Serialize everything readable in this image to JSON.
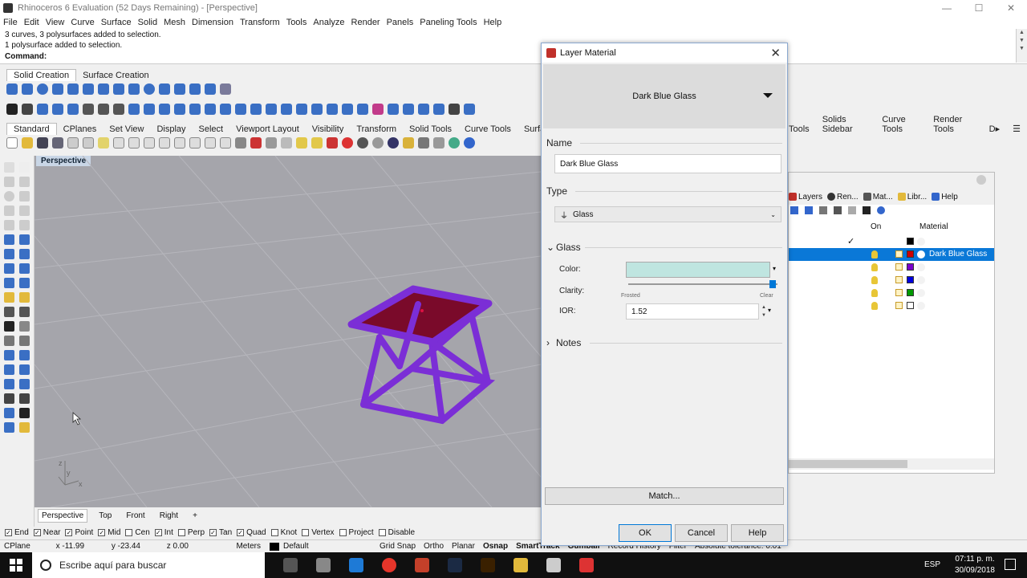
{
  "window": {
    "title": "Rhinoceros 6 Evaluation (52 Days Remaining) - [Perspective]",
    "min": "—",
    "max": "☐",
    "close": "✕"
  },
  "menu": [
    "File",
    "Edit",
    "View",
    "Curve",
    "Surface",
    "Solid",
    "Mesh",
    "Dimension",
    "Transform",
    "Tools",
    "Analyze",
    "Render",
    "Panels",
    "Paneling Tools",
    "Help"
  ],
  "command": {
    "history": [
      "3 curves, 3 polysurfaces added to selection.",
      "1 polysurface added to selection."
    ],
    "prompt": "Command:"
  },
  "toolbar_tabs_top": [
    "Solid Creation",
    "Surface Creation"
  ],
  "toolbar_tabs_main": [
    "Standard",
    "CPlanes",
    "Set View",
    "Display",
    "Select",
    "Viewport Layout",
    "Visibility",
    "Transform",
    "Solid Tools",
    "Curve Tools",
    "Surface"
  ],
  "toolbar_tabs_right": [
    "Tools",
    "Solids Sidebar",
    "Curve Tools",
    "Render Tools",
    "D▸",
    "☰"
  ],
  "viewport": {
    "label": "Perspective",
    "axis_y": "y",
    "axis_x": "x",
    "axis_z": "z"
  },
  "viewport_tabs": [
    "Perspective",
    "Top",
    "Front",
    "Right",
    "+"
  ],
  "osnap": [
    {
      "label": "End",
      "checked": true
    },
    {
      "label": "Near",
      "checked": true
    },
    {
      "label": "Point",
      "checked": true
    },
    {
      "label": "Mid",
      "checked": true
    },
    {
      "label": "Cen",
      "checked": false
    },
    {
      "label": "Int",
      "checked": true
    },
    {
      "label": "Perp",
      "checked": false
    },
    {
      "label": "Tan",
      "checked": true
    },
    {
      "label": "Quad",
      "checked": true
    },
    {
      "label": "Knot",
      "checked": false
    },
    {
      "label": "Vertex",
      "checked": false
    },
    {
      "label": "Project",
      "checked": false
    },
    {
      "label": "Disable",
      "checked": false
    }
  ],
  "status": {
    "cplane": "CPlane",
    "x": "x -11.99",
    "y": "y -23.44",
    "z": "z 0.00",
    "units": "Meters",
    "layer": "Default",
    "grid": "Grid Snap",
    "ortho": "Ortho",
    "planar": "Planar",
    "osnap": "Osnap",
    "smarttrack": "SmartTrack",
    "gumball": "Gumball",
    "record": "Record History",
    "filter": "Filter",
    "tolerance": "Absolute tolerance: 0.01"
  },
  "taskbar": {
    "search": "Escribe aquí para buscar",
    "lang": "ESP",
    "time": "07:11 p. m.",
    "date": "30/09/2018"
  },
  "layers_panel": {
    "tabs": [
      "Layers",
      "Ren...",
      "Mat...",
      "Libr...",
      "Help"
    ],
    "col_on": "On",
    "col_material": "Material",
    "rows": [
      {
        "color": "#000000",
        "material": "",
        "selected": false,
        "check": "✓"
      },
      {
        "color": "#cc0000",
        "material": "Dark Blue Glass",
        "selected": true,
        "check": ""
      },
      {
        "color": "#7a00cc",
        "material": "",
        "selected": false,
        "check": ""
      },
      {
        "color": "#0000dd",
        "material": "",
        "selected": false,
        "check": ""
      },
      {
        "color": "#009900",
        "material": "",
        "selected": false,
        "check": ""
      },
      {
        "color": "#ffffff",
        "material": "",
        "selected": false,
        "check": ""
      }
    ]
  },
  "dialog": {
    "title": "Layer Material",
    "preview_name": "Dark Blue Glass",
    "name_label": "Name",
    "name_value": "Dark Blue Glass",
    "type_label": "Type",
    "type_value": "Glass",
    "glass_label": "Glass",
    "color_label": "Color:",
    "color_value": "#bfe5e0",
    "clarity_label": "Clarity:",
    "clarity_min": "Frosted",
    "clarity_max": "Clear",
    "clarity_level": 0.98,
    "ior_label": "IOR:",
    "ior_value": "1.52",
    "notes_label": "Notes",
    "match": "Match...",
    "ok": "OK",
    "cancel": "Cancel",
    "help": "Help"
  }
}
